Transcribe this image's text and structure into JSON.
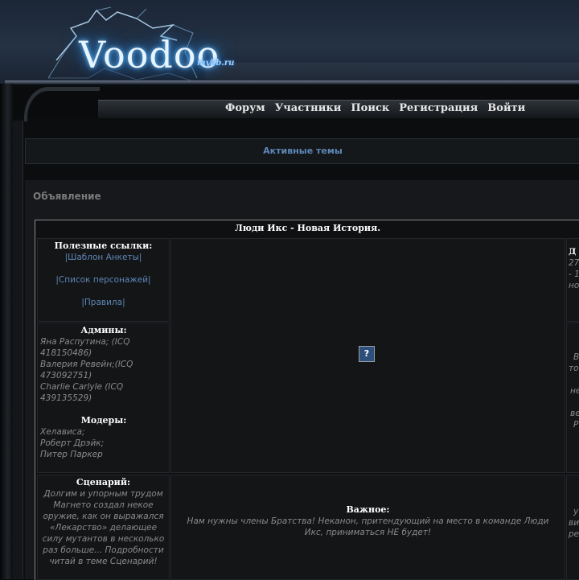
{
  "header": {
    "logo_text": "Voodoo",
    "logo_sub": "mybb.ru"
  },
  "nav": {
    "items": [
      "Форум",
      "Участники",
      "Поиск",
      "Регистрация",
      "Войти"
    ]
  },
  "active_topics": {
    "label": "Активные темы"
  },
  "announcement": {
    "title": "Объявление",
    "table_title": "Люди Икс - Новая История.",
    "useful_links": {
      "heading": "Полезные ссылки:",
      "links": [
        "|Шаблон Анкеты|",
        "|Список персонажей|",
        "|Правила|"
      ]
    },
    "admins": {
      "heading": "Админы:",
      "lines": [
        "Яна Распутина; (ICQ",
        "418150486)",
        "Валерия Ревейн;(ICQ",
        "473092751)",
        "Charlie Carlyle (ICQ",
        "439135529)"
      ]
    },
    "moders": {
      "heading": "Модеры:",
      "lines": [
        "Хелависа;",
        "Роберт Дрэйк;",
        "Питер Паркер"
      ]
    },
    "scenario": {
      "heading": "Сценарий:",
      "lines": [
        "Долгим и упорным трудом",
        "Магнето создал некое",
        "оружие, как он выражался",
        "«Лекарство» делающее",
        "силу мутантов в несколько",
        "раз больше... Подробности",
        "читай в теме Сценарий!"
      ]
    },
    "important": {
      "heading": "Важное:",
      "lines": [
        "Нам нужны члены Братства! Неканон, притендующий на место в команде Люди",
        "Икс, приниматься НЕ будет!"
      ]
    },
    "image_placeholder": "?",
    "right_fragments": {
      "top": [
        "Д",
        "27",
        "- 1",
        "но"
      ],
      "middle": [
        "В",
        "то",
        "не",
        "ве",
        "Р"
      ],
      "bottom": [
        "у",
        "ви",
        "ре"
      ]
    }
  },
  "colors": {
    "link": "#5d87b7",
    "heading": "#ffffff",
    "muted": "#8a8a8a",
    "logo_glow": "#6ac2ff"
  }
}
